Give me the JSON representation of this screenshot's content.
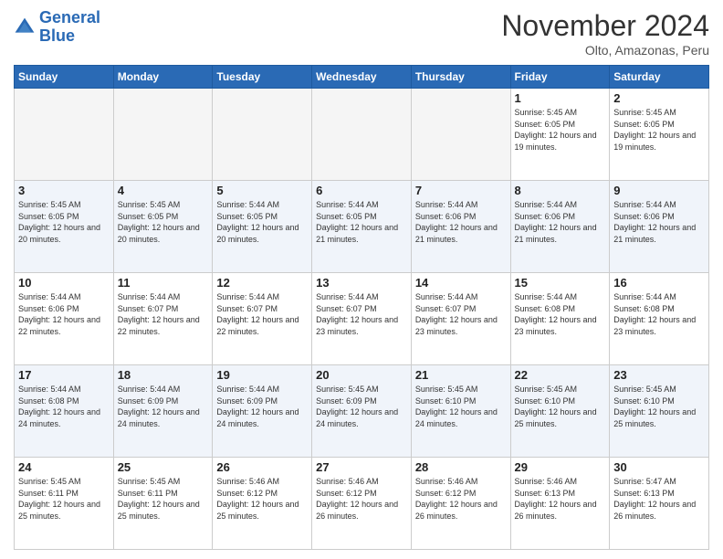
{
  "logo": {
    "line1": "General",
    "line2": "Blue"
  },
  "title": "November 2024",
  "subtitle": "Olto, Amazonas, Peru",
  "weekdays": [
    "Sunday",
    "Monday",
    "Tuesday",
    "Wednesday",
    "Thursday",
    "Friday",
    "Saturday"
  ],
  "weeks": [
    [
      {
        "day": "",
        "info": ""
      },
      {
        "day": "",
        "info": ""
      },
      {
        "day": "",
        "info": ""
      },
      {
        "day": "",
        "info": ""
      },
      {
        "day": "",
        "info": ""
      },
      {
        "day": "1",
        "info": "Sunrise: 5:45 AM\nSunset: 6:05 PM\nDaylight: 12 hours and 19 minutes."
      },
      {
        "day": "2",
        "info": "Sunrise: 5:45 AM\nSunset: 6:05 PM\nDaylight: 12 hours and 19 minutes."
      }
    ],
    [
      {
        "day": "3",
        "info": "Sunrise: 5:45 AM\nSunset: 6:05 PM\nDaylight: 12 hours and 20 minutes."
      },
      {
        "day": "4",
        "info": "Sunrise: 5:45 AM\nSunset: 6:05 PM\nDaylight: 12 hours and 20 minutes."
      },
      {
        "day": "5",
        "info": "Sunrise: 5:44 AM\nSunset: 6:05 PM\nDaylight: 12 hours and 20 minutes."
      },
      {
        "day": "6",
        "info": "Sunrise: 5:44 AM\nSunset: 6:05 PM\nDaylight: 12 hours and 21 minutes."
      },
      {
        "day": "7",
        "info": "Sunrise: 5:44 AM\nSunset: 6:06 PM\nDaylight: 12 hours and 21 minutes."
      },
      {
        "day": "8",
        "info": "Sunrise: 5:44 AM\nSunset: 6:06 PM\nDaylight: 12 hours and 21 minutes."
      },
      {
        "day": "9",
        "info": "Sunrise: 5:44 AM\nSunset: 6:06 PM\nDaylight: 12 hours and 21 minutes."
      }
    ],
    [
      {
        "day": "10",
        "info": "Sunrise: 5:44 AM\nSunset: 6:06 PM\nDaylight: 12 hours and 22 minutes."
      },
      {
        "day": "11",
        "info": "Sunrise: 5:44 AM\nSunset: 6:07 PM\nDaylight: 12 hours and 22 minutes."
      },
      {
        "day": "12",
        "info": "Sunrise: 5:44 AM\nSunset: 6:07 PM\nDaylight: 12 hours and 22 minutes."
      },
      {
        "day": "13",
        "info": "Sunrise: 5:44 AM\nSunset: 6:07 PM\nDaylight: 12 hours and 23 minutes."
      },
      {
        "day": "14",
        "info": "Sunrise: 5:44 AM\nSunset: 6:07 PM\nDaylight: 12 hours and 23 minutes."
      },
      {
        "day": "15",
        "info": "Sunrise: 5:44 AM\nSunset: 6:08 PM\nDaylight: 12 hours and 23 minutes."
      },
      {
        "day": "16",
        "info": "Sunrise: 5:44 AM\nSunset: 6:08 PM\nDaylight: 12 hours and 23 minutes."
      }
    ],
    [
      {
        "day": "17",
        "info": "Sunrise: 5:44 AM\nSunset: 6:08 PM\nDaylight: 12 hours and 24 minutes."
      },
      {
        "day": "18",
        "info": "Sunrise: 5:44 AM\nSunset: 6:09 PM\nDaylight: 12 hours and 24 minutes."
      },
      {
        "day": "19",
        "info": "Sunrise: 5:44 AM\nSunset: 6:09 PM\nDaylight: 12 hours and 24 minutes."
      },
      {
        "day": "20",
        "info": "Sunrise: 5:45 AM\nSunset: 6:09 PM\nDaylight: 12 hours and 24 minutes."
      },
      {
        "day": "21",
        "info": "Sunrise: 5:45 AM\nSunset: 6:10 PM\nDaylight: 12 hours and 24 minutes."
      },
      {
        "day": "22",
        "info": "Sunrise: 5:45 AM\nSunset: 6:10 PM\nDaylight: 12 hours and 25 minutes."
      },
      {
        "day": "23",
        "info": "Sunrise: 5:45 AM\nSunset: 6:10 PM\nDaylight: 12 hours and 25 minutes."
      }
    ],
    [
      {
        "day": "24",
        "info": "Sunrise: 5:45 AM\nSunset: 6:11 PM\nDaylight: 12 hours and 25 minutes."
      },
      {
        "day": "25",
        "info": "Sunrise: 5:45 AM\nSunset: 6:11 PM\nDaylight: 12 hours and 25 minutes."
      },
      {
        "day": "26",
        "info": "Sunrise: 5:46 AM\nSunset: 6:12 PM\nDaylight: 12 hours and 25 minutes."
      },
      {
        "day": "27",
        "info": "Sunrise: 5:46 AM\nSunset: 6:12 PM\nDaylight: 12 hours and 26 minutes."
      },
      {
        "day": "28",
        "info": "Sunrise: 5:46 AM\nSunset: 6:12 PM\nDaylight: 12 hours and 26 minutes."
      },
      {
        "day": "29",
        "info": "Sunrise: 5:46 AM\nSunset: 6:13 PM\nDaylight: 12 hours and 26 minutes."
      },
      {
        "day": "30",
        "info": "Sunrise: 5:47 AM\nSunset: 6:13 PM\nDaylight: 12 hours and 26 minutes."
      }
    ]
  ]
}
